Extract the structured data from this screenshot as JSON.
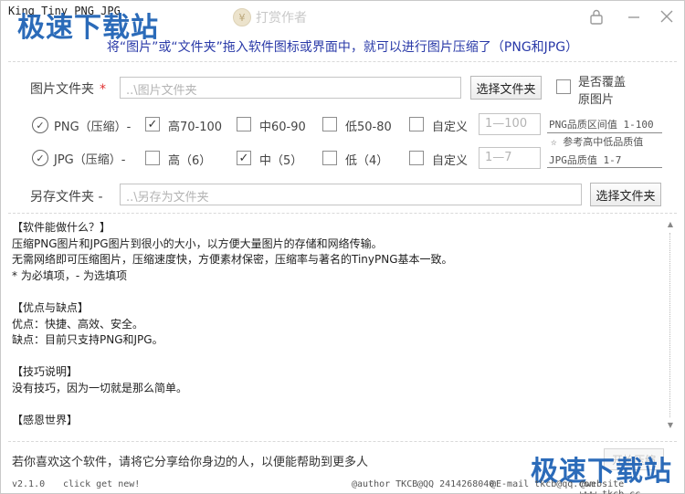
{
  "app_title": "King Tiny PNG JPG",
  "reward_label": "打赏作者",
  "reward_icon": "coin-icon",
  "watermark": "极速下载站",
  "hint": "将“图片”或“文件夹”拖入软件图标或界面中，就可以进行图片压缩了（PNG和JPG）",
  "image_folder": {
    "label": "图片文件夹",
    "required_mark": "*",
    "placeholder": "..\\图片文件夹",
    "select_button": "选择文件夹",
    "overwrite_line1": "是否覆盖",
    "overwrite_line2": "原图片"
  },
  "png": {
    "label": "PNG（压缩）-",
    "options": [
      {
        "label": "高70-100",
        "checked": true
      },
      {
        "label": "中60-90",
        "checked": false
      },
      {
        "label": "低50-80",
        "checked": false
      }
    ],
    "custom_label": "自定义",
    "custom_placeholder": "1—100",
    "range_note": "PNG品质区间值 1-100"
  },
  "mid_note": "☆ 参考高中低品质值",
  "jpg": {
    "label": "JPG（压缩）-",
    "options": [
      {
        "label": "高（6）",
        "checked": false
      },
      {
        "label": "中（5）",
        "checked": true
      },
      {
        "label": "低（4）",
        "checked": false
      }
    ],
    "custom_label": "自定义",
    "custom_placeholder": "1—7",
    "range_note": "JPG品质值 1-7"
  },
  "save_folder": {
    "label": "另存文件夹 -",
    "placeholder": "..\\另存为文件夹",
    "select_button": "选择文件夹"
  },
  "info_lines": [
    "【软件能做什么？】",
    "压缩PNG图片和JPG图片到很小的大小，以方便大量图片的存储和网络传输。",
    "无需网络即可压缩图片，压缩速度快，方便素材保密，压缩率与著名的TinyPNG基本一致。",
    "* 为必填项，- 为选填项",
    "",
    "【优点与缺点】",
    "优点：快捷、高效、安全。",
    "缺点：目前只支持PNG和JPG。",
    "",
    "【技巧说明】",
    "没有技巧，因为一切就是那么简单。",
    "",
    "【感恩世界】"
  ],
  "share_text": "若你喜欢这个软件，请将它分享给你身边的人，以便能帮助到更多人",
  "ghost_button": "开始压缩",
  "status": {
    "version": "v2.1.0",
    "tagline": "click get new!",
    "author": "@author TKCB",
    "qq": "@QQ 2414268040",
    "email": "@E-mail tkcb@qq.com",
    "website": "@website www.tkcb.cc"
  },
  "colors": {
    "hint_text": "#2a3aa8",
    "required": "#e03030",
    "watermark": "#1a5fb4"
  }
}
